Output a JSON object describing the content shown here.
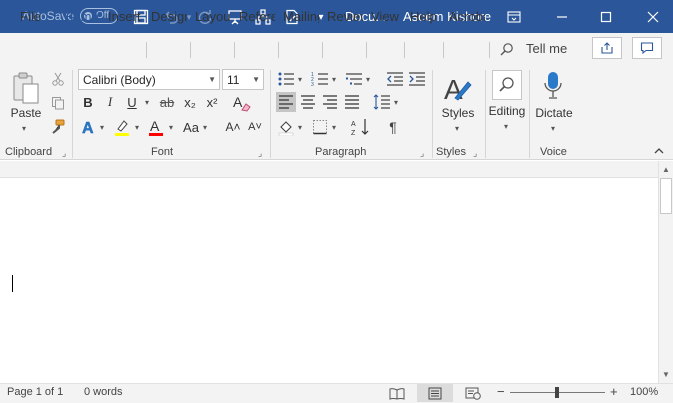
{
  "titlebar": {
    "autosave_label": "AutoSave",
    "autosave_state": "Off",
    "doc_title": "Docu...",
    "user_name": "Aseem Kishore"
  },
  "tabs": {
    "items": [
      "File",
      "Home",
      "Insert",
      "Design",
      "Layout",
      "References",
      "Mailings",
      "Review",
      "View",
      "Help",
      "Acrobat"
    ],
    "active": "Home",
    "tell_me": "Tell me"
  },
  "ribbon": {
    "clipboard": {
      "label": "Clipboard",
      "paste": "Paste"
    },
    "font": {
      "label": "Font",
      "name": "Calibri (Body)",
      "size": "11",
      "bold": "B",
      "italic": "I",
      "underline": "U",
      "strike": "ab",
      "sub": "x₂",
      "super": "x²",
      "case": "Aa",
      "grow": "A˄",
      "shrink": "A˅"
    },
    "paragraph": {
      "label": "Paragraph"
    },
    "styles": {
      "label": "Styles",
      "button": "Styles"
    },
    "editing": {
      "button": "Editing"
    },
    "voice": {
      "label": "Voice",
      "button": "Dictate"
    }
  },
  "status": {
    "page": "Page 1 of 1",
    "words": "0 words",
    "zoom": "100%"
  },
  "colors": {
    "titlebar": "#2b579a",
    "ribbon": "#f3f3f3",
    "accent": "#2b579a",
    "highlight": "#ffff00",
    "font_color": "#ff0000"
  }
}
